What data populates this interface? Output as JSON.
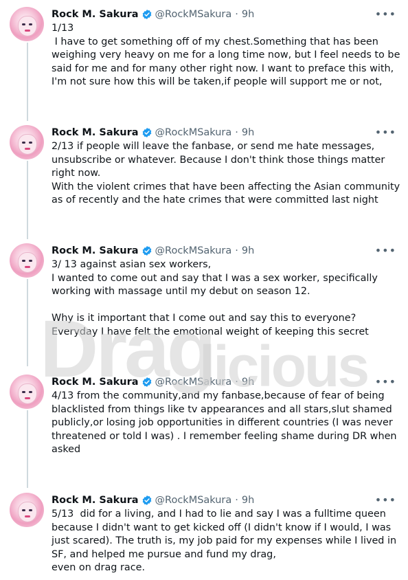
{
  "user": {
    "name": "Rock M. Sakura",
    "handle": "@RockMSakura",
    "separator": "·",
    "time": "9h",
    "verified": true
  },
  "more_icon": "more-horizontal-icon",
  "tweets": [
    {
      "text": "1/13\n I have to get something off of my chest.Something that has been weighing very heavy on me for a long time now, but I feel needs to be said for me and for many other right now. I want to preface this with, I'm not sure how this will be taken,if people will support me or not,"
    },
    {
      "text": "2/13 if people will leave the fanbase, or send me hate messages, unsubscribe or whatever. Because I don't think those things matter right now.\nWith the violent crimes that have been affecting the Asian community as of recently and the hate crimes that were committed last night"
    },
    {
      "text": "3/ 13 against asian sex workers,\nI wanted to come out and say that I was a sex worker, specifically working with massage until my debut on season 12.\n\nWhy is it important that I come out and say this to everyone? Everyday I have felt the emotional weight of keeping this secret"
    },
    {
      "text": "4/13 from the community,and my fanbase,because of fear of being blacklisted from things like tv appearances and all stars,slut shamed publicly,or losing job opportunities in different countries (I was never threatened or told I was) . I remember feeling shame during DR when asked"
    },
    {
      "text": "5/13  did for a living, and I had to lie and say I was a fulltime queen because I didn't want to get kicked off (I didn't know if I would, I was just scared). The truth is, my job paid for my expenses while I lived in SF, and helped me pursue and fund my drag,\neven on drag race."
    }
  ],
  "watermark": {
    "text_a": "Drag",
    "text_b": "licious"
  },
  "colors": {
    "text": "#0f1419",
    "secondary": "#536471",
    "verified": "#1d9bf0",
    "thread_line": "#cfd9de"
  }
}
